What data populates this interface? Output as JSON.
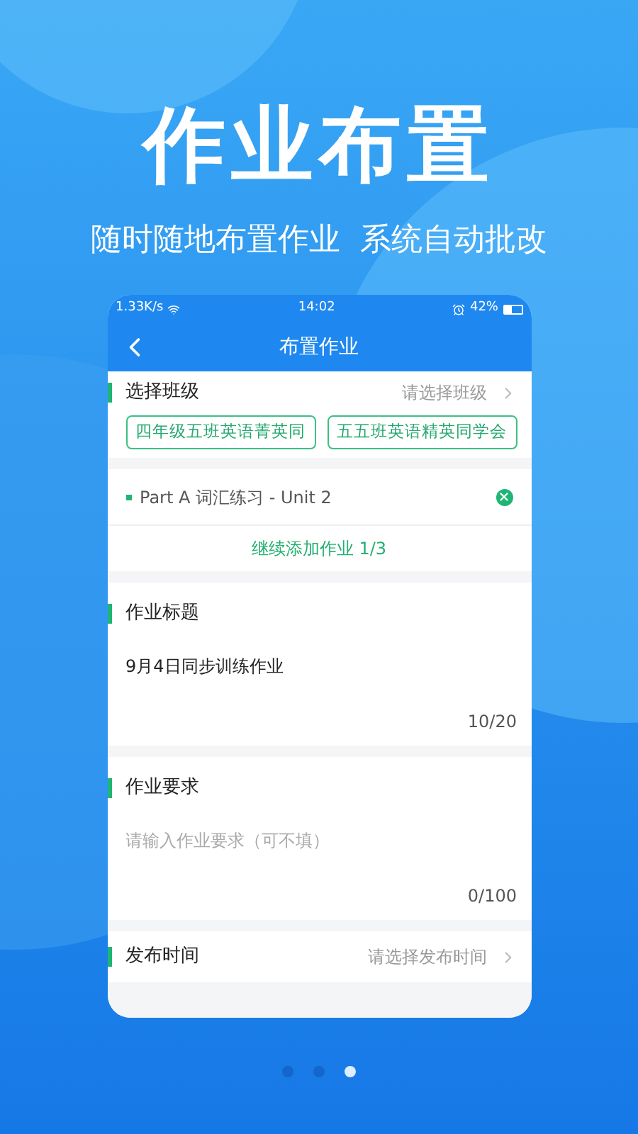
{
  "headline": "作业布置",
  "subtitle": "随时随地布置作业  系统自动批改",
  "status_bar": {
    "network": "1.33K/s",
    "time": "14:02",
    "battery": "42%"
  },
  "nav": {
    "title": "布置作业"
  },
  "class_select": {
    "label": "选择班级",
    "placeholder": "请选择班级",
    "classes": [
      "四年级五班英语菁英同",
      "五五班英语精英同学会"
    ]
  },
  "assignments": [
    {
      "name": "Part A 词汇练习 - Unit 2"
    }
  ],
  "add_button": "继续添加作业 1/3",
  "title_field": {
    "label": "作业标题",
    "value": "9月4日同步训练作业",
    "counter": "10/20"
  },
  "requirement_field": {
    "label": "作业要求",
    "placeholder": "请输入作业要求（可不填）",
    "counter": "0/100"
  },
  "publish_time": {
    "label": "发布时间",
    "placeholder": "请选择发布时间"
  },
  "pager": [
    {
      "selected": false
    },
    {
      "selected": false
    },
    {
      "selected": true
    }
  ]
}
